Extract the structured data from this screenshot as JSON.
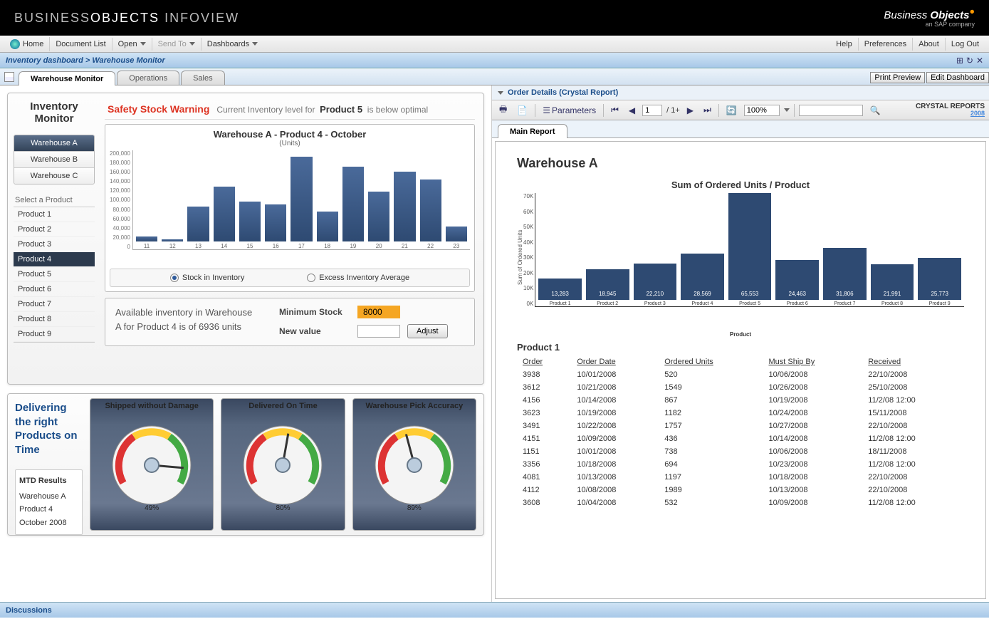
{
  "brand": {
    "left1": "BUSINESS",
    "left2": "OBJECTS",
    "left3": "INFOVIEW",
    "logo1": "Business",
    "logo2": "Objects",
    "logo3": "an SAP company"
  },
  "menubar": {
    "home": "Home",
    "doclist": "Document List",
    "open": "Open",
    "sendto": "Send To",
    "dashboards": "Dashboards",
    "help": "Help",
    "prefs": "Preferences",
    "about": "About",
    "logout": "Log Out"
  },
  "breadcrumb": "Inventory dashboard > Warehouse Monitor",
  "tabs": [
    "Warehouse Monitor",
    "Operations",
    "Sales"
  ],
  "tabstrip_buttons": {
    "print": "Print Preview",
    "edit": "Edit Dashboard"
  },
  "inv": {
    "title": "Inventory Monitor",
    "warehouses": [
      "Warehouse A",
      "Warehouse B",
      "Warehouse C"
    ],
    "select_label": "Select a Product",
    "products": [
      "Product 1",
      "Product 2",
      "Product 3",
      "Product 4",
      "Product 5",
      "Product 6",
      "Product 7",
      "Product 8",
      "Product 9"
    ],
    "warn_title": "Safety Stock Warning",
    "warn_pre": "Current Inventory level for",
    "warn_prod": "Product 5",
    "warn_post": "is below optimal",
    "chart_title": "Warehouse A - Product 4 - October",
    "chart_sub": "(Units)",
    "legend1": "Stock in Inventory",
    "legend2": "Excess Inventory Average",
    "adjust_text": "Available inventory in Warehouse A for Product 4 is of 6936 units",
    "min_label": "Minimum Stock",
    "min_value": "8000",
    "new_label": "New value",
    "adjust_btn": "Adjust"
  },
  "gauges": {
    "title": "Delivering the right Products on Time",
    "mtd_title": "MTD Results",
    "mtd_lines": [
      "Warehouse A",
      "Product 4",
      "October 2008"
    ],
    "items": [
      {
        "title": "Shipped without Damage",
        "pct": "49%",
        "needle": 95
      },
      {
        "title": "Delivered On Time",
        "pct": "80%",
        "needle": 10
      },
      {
        "title": "Warehouse Pick Accuracy",
        "pct": "89%",
        "needle": -15
      }
    ]
  },
  "right": {
    "title": "Order Details (Crystal Report)",
    "params": "Parameters",
    "page": "1",
    "pages": "/ 1+",
    "zoom": "100%",
    "cr": "CRYSTAL REPORTS",
    "cr_year": "2008",
    "tab": "Main Report",
    "wh": "Warehouse A",
    "chart_title": "Sum of Ordered Units / Product",
    "ylabel": "Sum of Ordered Units",
    "xlabel": "Product",
    "dt_title": "Product 1",
    "cols": [
      "Order",
      "Order Date",
      "Ordered Units",
      "Must Ship By",
      "Received"
    ],
    "rows": [
      [
        "3938",
        "10/01/2008",
        "520",
        "10/06/2008",
        "22/10/2008"
      ],
      [
        "3612",
        "10/21/2008",
        "1549",
        "10/26/2008",
        "25/10/2008"
      ],
      [
        "4156",
        "10/14/2008",
        "867",
        "10/19/2008",
        "11/2/08 12:00"
      ],
      [
        "3623",
        "10/19/2008",
        "1182",
        "10/24/2008",
        "15/11/2008"
      ],
      [
        "3491",
        "10/22/2008",
        "1757",
        "10/27/2008",
        "22/10/2008"
      ],
      [
        "4151",
        "10/09/2008",
        "436",
        "10/14/2008",
        "11/2/08 12:00"
      ],
      [
        "1151",
        "10/01/2008",
        "738",
        "10/06/2008",
        "18/11/2008"
      ],
      [
        "3356",
        "10/18/2008",
        "694",
        "10/23/2008",
        "11/2/08 12:00"
      ],
      [
        "4081",
        "10/13/2008",
        "1197",
        "10/18/2008",
        "22/10/2008"
      ],
      [
        "4112",
        "10/08/2008",
        "1989",
        "10/13/2008",
        "22/10/2008"
      ],
      [
        "3608",
        "10/04/2008",
        "532",
        "10/09/2008",
        "11/2/08 12:00"
      ]
    ]
  },
  "bottom": "Discussions",
  "chart_data": [
    {
      "type": "bar",
      "title": "Warehouse A - Product 4 - October",
      "subtitle": "(Units)",
      "xlabel": "",
      "ylabel": "Units",
      "ylim": [
        0,
        200000
      ],
      "categories": [
        "11",
        "12",
        "13",
        "14",
        "15",
        "16",
        "17",
        "18",
        "19",
        "20",
        "21",
        "22",
        "23"
      ],
      "values": [
        10000,
        5000,
        70000,
        110000,
        80000,
        75000,
        170000,
        60000,
        150000,
        100000,
        140000,
        125000,
        30000
      ],
      "y_ticks": [
        "200,000",
        "180,000",
        "160,000",
        "140,000",
        "120,000",
        "100,000",
        "80,000",
        "60,000",
        "40,000",
        "20,000",
        "0"
      ]
    },
    {
      "type": "bar",
      "title": "Sum of Ordered Units / Product",
      "xlabel": "Product",
      "ylabel": "Sum of Ordered Units",
      "ylim": [
        0,
        70000
      ],
      "categories": [
        "Product 1",
        "Product 2",
        "Product 3",
        "Product 4",
        "Product 5",
        "Product 6",
        "Product 7",
        "Product 8",
        "Product 9"
      ],
      "values": [
        13283,
        18945,
        22210,
        28569,
        65553,
        24463,
        31806,
        21991,
        25773
      ],
      "y_ticks": [
        "70K",
        "60K",
        "50K",
        "40K",
        "30K",
        "20K",
        "10K",
        "0K"
      ]
    }
  ]
}
